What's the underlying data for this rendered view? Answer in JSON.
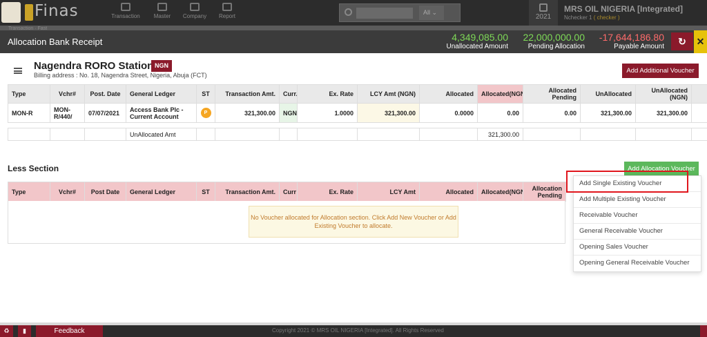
{
  "app": {
    "logo_text": "Finas"
  },
  "topnav": {
    "items": [
      {
        "label": "Transaction"
      },
      {
        "label": "Master"
      },
      {
        "label": "Company"
      },
      {
        "label": "Report"
      }
    ],
    "search": {
      "placeholder": "",
      "scope": "All"
    },
    "year": "2021",
    "company": "MRS OIL NIGERIA [Integrated]",
    "user": "Nchecker 1",
    "role": "( checker )"
  },
  "subnav": {
    "text": "Transaction · Fast"
  },
  "header": {
    "title": "Allocation Bank Receipt",
    "stats": [
      {
        "value": "4,349,085.00",
        "label": "Unallocated Amount",
        "color": "#7ed957"
      },
      {
        "value": "22,000,000.00",
        "label": "Pending Allocation",
        "color": "#7ed957"
      },
      {
        "value": "-17,644,186.80",
        "label": "Payable Amount",
        "color": "#ff6b6b"
      }
    ]
  },
  "party": {
    "name": "Nagendra RORO Station1",
    "currency": "NGN",
    "billing": "Billing address : No. 18, Nagendra Street, Nigeria, Abuja (FCT)"
  },
  "buttons": {
    "add_additional": "Add Additional Voucher",
    "add_allocation": "Add Allocation Voucher"
  },
  "main_table": {
    "headers": [
      "Type",
      "Vchr#",
      "Post. Date",
      "General Ledger",
      "ST",
      "Transaction Amt.",
      "Curr.",
      "Ex. Rate",
      "LCY Amt (NGN)",
      "Allocated",
      "Allocated(NGN)",
      "Allocated Pending",
      "UnAllocated",
      "UnAllocated (NGN)"
    ],
    "row": {
      "type": "MON-R",
      "vchr": "MON-R/440/",
      "post_date": "07/07/2021",
      "ledger": "Access Bank Plc - Current Account",
      "st": "P",
      "txn_amt": "321,300.00",
      "curr": "NGN",
      "ex_rate": "1.0000",
      "lcy_amt": "321,300.00",
      "allocated": "0.0000",
      "allocated_ngn": "0.00",
      "alloc_pending": "0.00",
      "unallocated": "321,300.00",
      "unallocated_ngn": "321,300.00"
    },
    "summary": {
      "label": "UnAllocated Amt",
      "value": "321,300.00"
    }
  },
  "less_section": {
    "title": "Less Section",
    "headers": [
      "Type",
      "Vchr#",
      "Post Date",
      "General Ledger",
      "ST",
      "Transaction Amt.",
      "Curr",
      "Ex. Rate",
      "LCY Amt",
      "Allocated",
      "Allocated(NGN)",
      "Allocation Pending"
    ],
    "empty_message": "No Voucher allocated for Allocation section. Click Add New Voucher or Add Existing Voucher to allocate."
  },
  "dropdown": {
    "items": [
      "Add Single Existing Voucher",
      "Add Multiple Existing Voucher",
      "Receivable Voucher",
      "General Receivable Voucher",
      "Opening Sales Voucher",
      "Opening General Receivable Voucher"
    ]
  },
  "footer": {
    "feedback": "Feedback",
    "copyright": "Copyright 2021 © MRS OIL NIGERIA [Integrated]. All Rights Reserved"
  },
  "colors": {
    "maroon": "#8b1a2b",
    "green": "#5cb85c",
    "highlight_red": "#e0151c",
    "yellow": "#e6c20a"
  }
}
